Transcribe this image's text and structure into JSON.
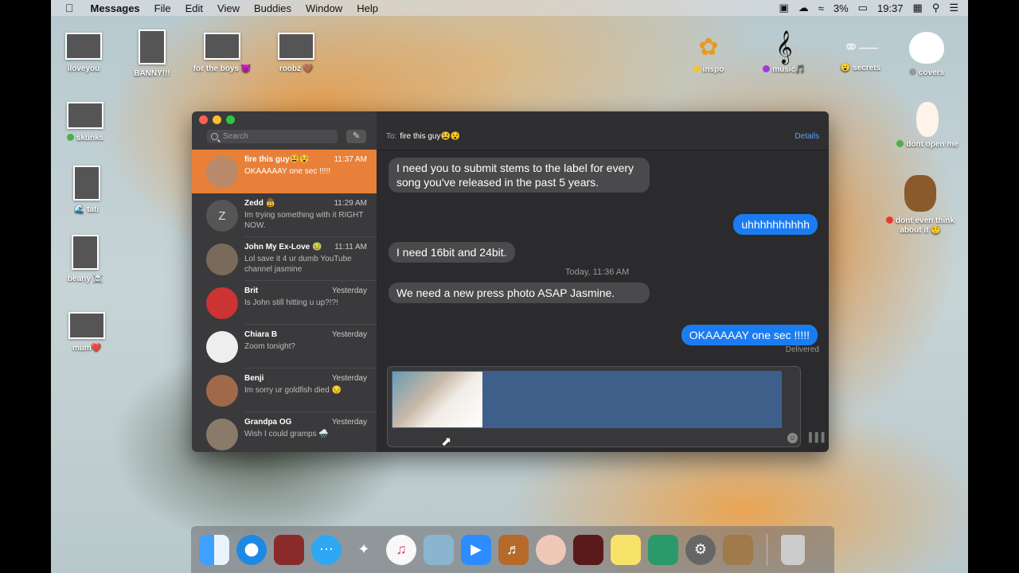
{
  "menubar": {
    "app_name": "Messages",
    "menus": [
      "File",
      "Edit",
      "View",
      "Buddies",
      "Window",
      "Help"
    ],
    "battery": "3%",
    "time": "19:37"
  },
  "desktop_icons": [
    {
      "label": "iloveyou"
    },
    {
      "label": "BANNY!!!"
    },
    {
      "label": "for the boys 😈"
    },
    {
      "label": "roobz 🤎"
    },
    {
      "label": "inspo"
    },
    {
      "label": "music🎵"
    },
    {
      "label": "😮 secrets"
    },
    {
      "label": "covers"
    },
    {
      "label": "skunks"
    },
    {
      "label": "dont open me"
    },
    {
      "label": "🌊 tati"
    },
    {
      "label": "dont even think about it 🤨"
    },
    {
      "label": "beany ☠️"
    },
    {
      "label": "mum❤️"
    }
  ],
  "sidebar": {
    "search_placeholder": "Search",
    "conversations": [
      {
        "name": "fire this guy😫😵",
        "time": "11:37 AM",
        "preview": "OKAAAAAY one sec !!!!!",
        "initial": ""
      },
      {
        "name": "Zedd 🤠",
        "time": "11:29 AM",
        "preview": "Im trying something with it RIGHT NOW.",
        "initial": "Z"
      },
      {
        "name": "John My Ex-Love 🤢",
        "time": "11:11 AM",
        "preview": "Lol save it 4 ur dumb YouTube channel jasmine",
        "initial": ""
      },
      {
        "name": "Brit",
        "time": "Yesterday",
        "preview": "Is John still hitting u up?!?!",
        "initial": ""
      },
      {
        "name": "Chiara B",
        "time": "Yesterday",
        "preview": "Zoom tonight?",
        "initial": ""
      },
      {
        "name": "Benji",
        "time": "Yesterday",
        "preview": "Im sorry ur goldfish died 😔",
        "initial": ""
      },
      {
        "name": "Grandpa OG",
        "time": "Yesterday",
        "preview": "Wish I could gramps 🌧️",
        "initial": ""
      }
    ]
  },
  "chat": {
    "to_label": "To:",
    "recipient": "fire this guy😫😵",
    "details_label": "Details",
    "messages": [
      {
        "text": "I need you to submit stems to the label for every song you've released in the past 5 years.",
        "from": "them"
      },
      {
        "text": "uhhhhhhhhhh",
        "from": "me"
      },
      {
        "text": "I need 16bit and 24bit.",
        "from": "them"
      },
      {
        "text": "We need a new press photo ASAP Jasmine.",
        "from": "them"
      },
      {
        "text": "OKAAAAAY one sec !!!!!",
        "from": "me"
      }
    ],
    "timestamp": "Today, 11:36 AM",
    "delivered_label": "Delivered"
  },
  "dock": [
    "finder-icon",
    "safari-icon",
    "photo-booth-icon",
    "messages-icon",
    "rocket-icon",
    "itunes-icon",
    "seal-icon",
    "zoom-icon",
    "garageband-icon",
    "face-icon",
    "photobooth-red-icon",
    "stickies-icon",
    "preview-icon",
    "settings-icon",
    "contacts-icon",
    "trash-icon"
  ],
  "colors": {
    "selected_row": "#e8803a",
    "sent_bubble": "#1b7cf2",
    "received_bubble": "#4a4a4c",
    "link": "#5aa0ff"
  }
}
